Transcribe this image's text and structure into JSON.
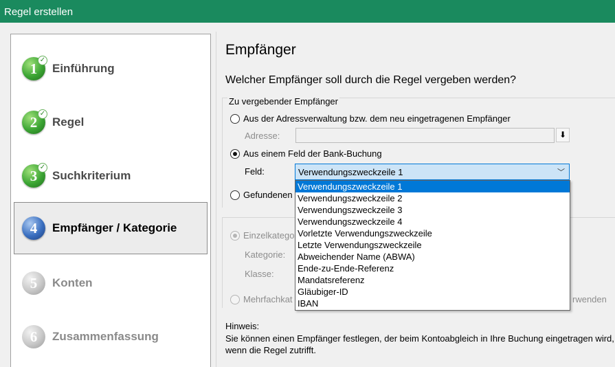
{
  "window": {
    "title": "Regel erstellen"
  },
  "steps": [
    {
      "number": "1",
      "label": "Einführung",
      "state": "done"
    },
    {
      "number": "2",
      "label": "Regel",
      "state": "done"
    },
    {
      "number": "3",
      "label": "Suchkriterium",
      "state": "done"
    },
    {
      "number": "4",
      "label": "Empfänger / Kategorie",
      "state": "current"
    },
    {
      "number": "5",
      "label": "Konten",
      "state": "pending"
    },
    {
      "number": "6",
      "label": "Zusammenfassung",
      "state": "pending"
    }
  ],
  "main": {
    "heading": "Empfänger",
    "question": "Welcher Empfänger soll durch die Regel vergeben werden?",
    "group_title": "Zu vergebender Empfänger",
    "option_address": "Aus der Adressverwaltung bzw. dem neu eingetragenen Empfänger",
    "address_label": "Adresse:",
    "address_value": "",
    "option_field": "Aus einem Feld der Bank-Buchung",
    "field_label": "Feld:",
    "field_selected": "Verwendungszweckzeile 1",
    "option_found_partial": "Gefundenen",
    "field_options": [
      "Verwendungszweckzeile 1",
      "Verwendungszweckzeile 2",
      "Verwendungszweckzeile 3",
      "Verwendungszweckzeile 4",
      "Vorletzte Verwendungszweckzeile",
      "Letzte Verwendungszweckzeile",
      "Abweichender Name (ABWA)",
      "Ende-zu-Ende-Referenz",
      "Mandatsreferenz",
      "Gläubiger-ID",
      "IBAN"
    ],
    "category": {
      "option_single_partial": "Einzelkatego",
      "category_label": "Kategorie:",
      "class_label": "Klasse:",
      "option_multi_partial": "Mehrfachkat",
      "multi_trailing_partial": "rwenden"
    },
    "hint_title": "Hinweis:",
    "hint_text": "Sie können einen Empfänger festlegen, der beim Kontoabgleich in Ihre Buchung eingetragen wird, wenn die Regel zutrifft."
  }
}
